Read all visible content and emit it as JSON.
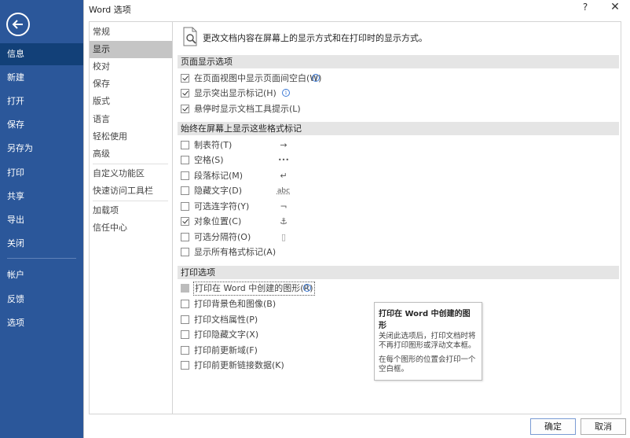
{
  "backstage": {
    "items": [
      {
        "label": "信息",
        "active": true
      },
      {
        "label": "新建"
      },
      {
        "label": "打开"
      },
      {
        "label": "保存"
      },
      {
        "label": "另存为"
      },
      {
        "label": "打印"
      },
      {
        "label": "共享"
      },
      {
        "label": "导出"
      },
      {
        "label": "关闭"
      },
      {
        "label": "帐户"
      },
      {
        "label": "反馈"
      },
      {
        "label": "选项"
      }
    ],
    "colors": {
      "bg": "#2b579a",
      "active": "#124078"
    }
  },
  "dialog": {
    "title": "Word 选项",
    "help": "?",
    "close": "✕"
  },
  "categories": [
    {
      "label": "常规"
    },
    {
      "label": "显示",
      "selected": true
    },
    {
      "label": "校对"
    },
    {
      "label": "保存"
    },
    {
      "label": "版式"
    },
    {
      "label": "语言"
    },
    {
      "label": "轻松使用"
    },
    {
      "label": "高级"
    },
    {
      "label": "自定义功能区"
    },
    {
      "label": "快速访问工具栏"
    },
    {
      "label": "加载项"
    },
    {
      "label": "信任中心"
    }
  ],
  "content": {
    "intro": "更改文档内容在屏幕上的显示方式和在打印时的显示方式。",
    "page_display": {
      "header": "页面显示选项",
      "options": [
        {
          "label": "在页面视图中显示页面间空白(W)",
          "checked": true,
          "info": true
        },
        {
          "label": "显示突出显示标记(H)",
          "checked": true,
          "info": true
        },
        {
          "label": "悬停时显示文档工具提示(L)",
          "checked": true
        }
      ]
    },
    "format_marks": {
      "header": "始终在屏幕上显示这些格式标记",
      "options": [
        {
          "label": "制表符(T)",
          "checked": false,
          "mark": "→"
        },
        {
          "label": "空格(S)",
          "checked": false,
          "mark": "•••"
        },
        {
          "label": "段落标记(M)",
          "checked": false,
          "mark": "↵"
        },
        {
          "label": "隐藏文字(D)",
          "checked": false,
          "mark": "abc"
        },
        {
          "label": "可选连字符(Y)",
          "checked": false,
          "mark": "¬"
        },
        {
          "label": "对象位置(C)",
          "checked": true,
          "mark": "⚓"
        },
        {
          "label": "可选分隔符(O)",
          "checked": false,
          "mark": "▯"
        },
        {
          "label": "显示所有格式标记(A)",
          "checked": false
        }
      ]
    },
    "print": {
      "header": "打印选项",
      "options": [
        {
          "label": "打印在 Word 中创建的图形(R)",
          "disabled": true,
          "info": true
        },
        {
          "label": "打印背景色和图像(B)",
          "checked": false
        },
        {
          "label": "打印文档属性(P)",
          "checked": false
        },
        {
          "label": "打印隐藏文字(X)",
          "checked": false
        },
        {
          "label": "打印前更新域(F)",
          "checked": false
        },
        {
          "label": "打印前更新链接数据(K)",
          "checked": false
        }
      ]
    }
  },
  "tooltip": {
    "title": "打印在 Word 中创建的图形",
    "body1": "关闭此选项后，打印文档时将不再打印图形或浮动文本框。",
    "body2": "在每个图形的位置会打印一个空白框。"
  },
  "buttons": {
    "ok": "确定",
    "cancel": "取消"
  }
}
